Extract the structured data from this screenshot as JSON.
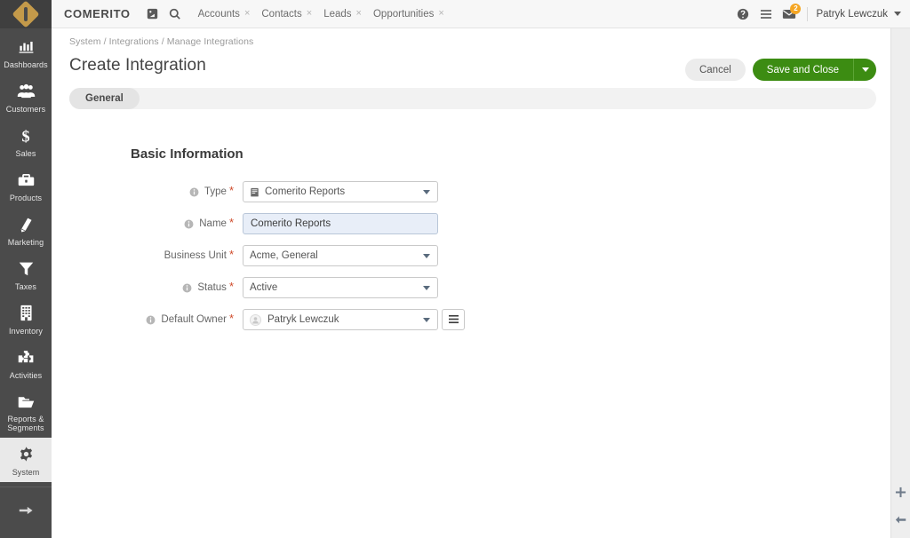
{
  "brand": {
    "name": "COMERITO",
    "logo_icon": "diamond-logo"
  },
  "topbar": {
    "pin_icon": "pin-board-icon",
    "search_icon": "search-icon",
    "tabs": [
      {
        "label": "Accounts",
        "close": "×"
      },
      {
        "label": "Contacts",
        "close": "×"
      },
      {
        "label": "Leads",
        "close": "×"
      },
      {
        "label": "Opportunities",
        "close": "×"
      }
    ],
    "help_icon": "help-circle-icon",
    "menu_icon": "hamburger-menu-icon",
    "mail_icon": "mail-icon",
    "mail_badge": "2",
    "user_name": "Patryk Lewczuk"
  },
  "sidebar": {
    "items": [
      {
        "label": "Dashboards",
        "icon": "bar-chart-icon",
        "active": false
      },
      {
        "label": "Customers",
        "icon": "people-group-icon",
        "active": false
      },
      {
        "label": "Sales",
        "icon": "dollar-sign-icon",
        "active": false
      },
      {
        "label": "Products",
        "icon": "briefcase-icon",
        "active": false
      },
      {
        "label": "Marketing",
        "icon": "book-icon",
        "active": false
      },
      {
        "label": "Taxes",
        "icon": "funnel-icon",
        "active": false
      },
      {
        "label": "Inventory",
        "icon": "building-icon",
        "active": false
      },
      {
        "label": "Activities",
        "icon": "puzzle-piece-icon",
        "active": false
      },
      {
        "label": "Reports & Segments",
        "icon": "folder-icon",
        "active": false
      },
      {
        "label": "System",
        "icon": "gear-icon",
        "active": true
      }
    ],
    "expand_icon": "arrow-right-icon"
  },
  "page": {
    "breadcrumb": "System / Integrations / Manage Integrations",
    "title": "Create Integration",
    "star_icon": "star-outline-icon",
    "pin_icon": "pushpin-icon",
    "cancel_label": "Cancel",
    "save_label": "Save and Close",
    "save_caret_icon": "chevron-down-icon"
  },
  "tabstrip": {
    "items": [
      {
        "label": "General",
        "active": true
      }
    ]
  },
  "form": {
    "section_title": "Basic Information",
    "fields": [
      {
        "label": "Type",
        "required": "*",
        "has_info": true,
        "info_icon": "info-circle-icon",
        "control": "select",
        "value": "Comerito Reports",
        "value_icon": "report-book-icon",
        "caret_icon": "chevron-down-icon"
      },
      {
        "label": "Name",
        "required": "*",
        "has_info": true,
        "info_icon": "info-circle-icon",
        "control": "text",
        "value": "Comerito Reports",
        "placeholder": ""
      },
      {
        "label": "Business Unit",
        "required": "*",
        "has_info": false,
        "control": "select",
        "value": "Acme, General",
        "caret_icon": "chevron-down-icon"
      },
      {
        "label": "Status",
        "required": "*",
        "has_info": true,
        "info_icon": "info-circle-icon",
        "control": "select",
        "value": "Active",
        "caret_icon": "chevron-down-icon"
      },
      {
        "label": "Default Owner",
        "required": "*",
        "has_info": true,
        "info_icon": "info-circle-icon",
        "control": "select-avatar",
        "value": "Patryk Lewczuk",
        "avatar_icon": "user-avatar-icon",
        "caret_icon": "chevron-down-icon",
        "side_button_icon": "list-picker-icon"
      }
    ]
  },
  "right_rail": {
    "add_icon": "plus-icon",
    "collapse_icon": "arrow-left-icon"
  },
  "colors": {
    "sidebar_bg": "#4b4b4b",
    "accent_green": "#3c8c12",
    "logo_gold": "#c49a4a",
    "badge_orange": "#f5a623",
    "required_red": "#cf4b2b",
    "input_focus_bg": "#e8eef8"
  }
}
